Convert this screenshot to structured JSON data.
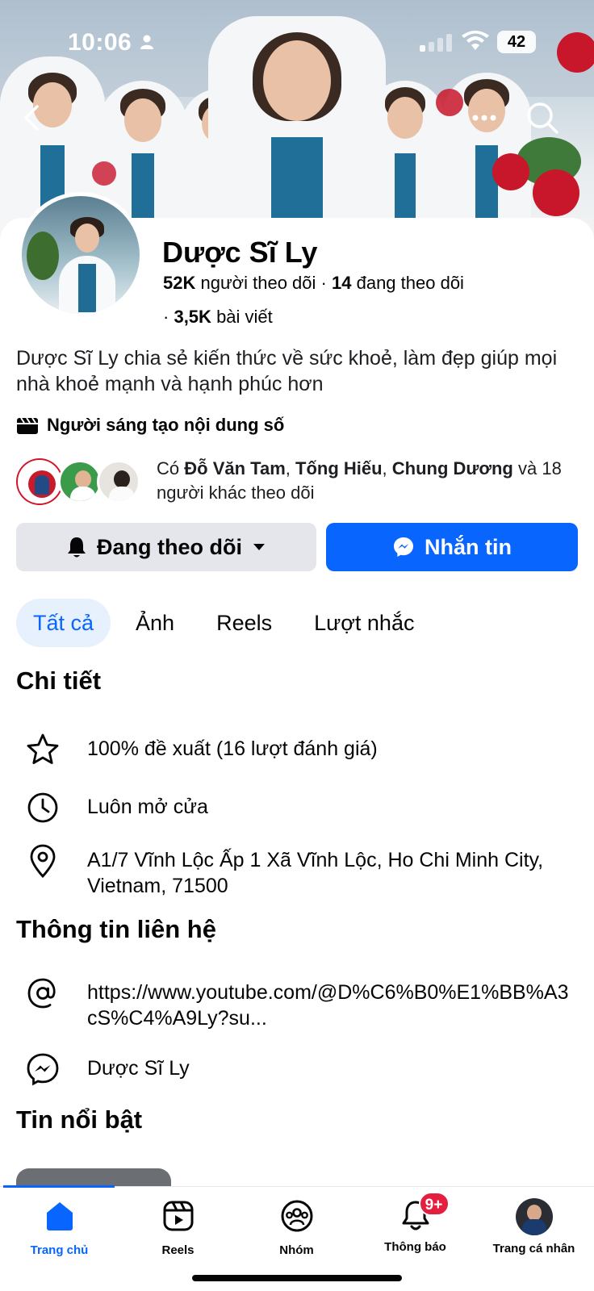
{
  "status_bar": {
    "time": "10:06",
    "battery": "42"
  },
  "profile": {
    "name": "Dược Sĩ Ly",
    "followers_count": "52K",
    "followers_label": "người theo dõi",
    "following_count": "14",
    "following_label": "đang theo dõi",
    "posts_count": "3,5K",
    "posts_label": "bài viết",
    "bio": "Dược Sĩ Ly chia sẻ kiến thức về sức khoẻ, làm đẹp giúp mọi nhà khoẻ mạnh và hạnh phúc hơn",
    "category": "Người sáng tạo nội dung số",
    "mutual": {
      "prefix": "Có",
      "names": [
        "Đỗ Văn Tam",
        "Tống Hiếu",
        "Chung Dương"
      ],
      "suffix": "và 18 người khác theo dõi"
    }
  },
  "actions": {
    "following_label": "Đang theo dõi",
    "message_label": "Nhắn tin"
  },
  "tabs": [
    {
      "label": "Tất cả",
      "active": true
    },
    {
      "label": "Ảnh",
      "active": false
    },
    {
      "label": "Reels",
      "active": false
    },
    {
      "label": "Lượt nhắc",
      "active": false
    }
  ],
  "details": {
    "title": "Chi tiết",
    "rating": "100% đề xuất (16 lượt đánh giá)",
    "hours": "Luôn mở cửa",
    "address": "A1/7 Vĩnh Lộc Ấp 1 Xã Vĩnh Lộc, Ho Chi Minh City, Vietnam, 71500"
  },
  "contact": {
    "title": "Thông tin liên hệ",
    "website": "https://www.youtube.com/@D%C6%B0%E1%BB%A3cS%C4%A9Ly?su...",
    "messenger": "Dược Sĩ Ly"
  },
  "highlights": {
    "title": "Tin nổi bật"
  },
  "bottom_nav": [
    {
      "label": "Trang chủ",
      "icon": "home-icon",
      "active": true
    },
    {
      "label": "Reels",
      "icon": "reels-icon",
      "active": false
    },
    {
      "label": "Nhóm",
      "icon": "groups-icon",
      "active": false
    },
    {
      "label": "Thông báo",
      "icon": "bell-icon",
      "active": false,
      "badge": "9+"
    },
    {
      "label": "Trang cá nhân",
      "icon": "profile-avatar",
      "active": false
    }
  ],
  "colors": {
    "accent": "#0866ff",
    "badge": "#e41e3f",
    "secondary_button": "#e4e6eb"
  }
}
